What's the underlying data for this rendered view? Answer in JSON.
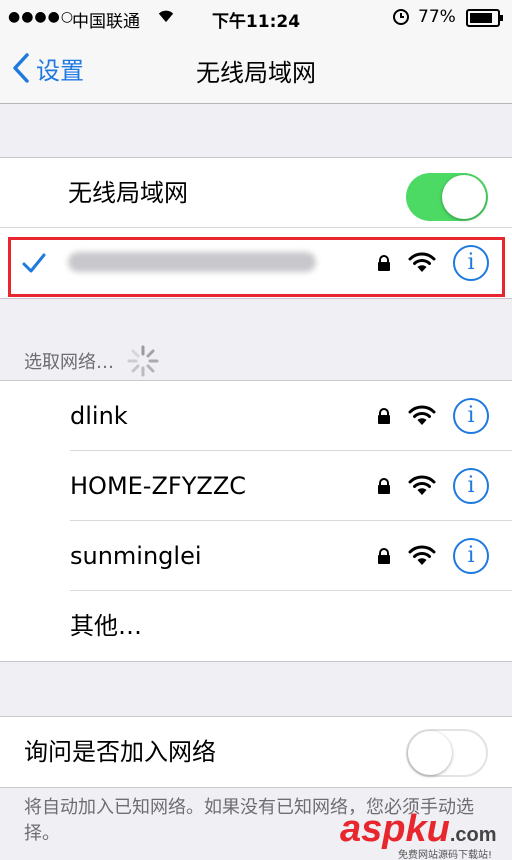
{
  "status_bar": {
    "signal": "●●●●○",
    "carrier": "中国联通",
    "time": "下午11:24",
    "battery": "77%"
  },
  "nav": {
    "back_label": "设置",
    "title": "无线局域网"
  },
  "wifi_toggle": {
    "label": "无线局域网",
    "on": true
  },
  "connected_network": {
    "name_obscured": true,
    "secured": true
  },
  "choose_network": {
    "header": "选取网络…",
    "networks": [
      {
        "name": "dlink",
        "secured": true
      },
      {
        "name": "HOME-ZFYZZC",
        "secured": true
      },
      {
        "name": "sunminglei",
        "secured": true
      }
    ],
    "other_label": "其他…"
  },
  "ask_to_join": {
    "label": "询问是否加入网络",
    "on": false,
    "footer": "将自动加入已知网络。如果没有已知网络，您必须手动选择。"
  },
  "watermark": {
    "brand": "aspku",
    "suffix": ".com",
    "tagline": "免费网站源码下载站!"
  },
  "colors": {
    "accent": "#1f7ae0",
    "toggle_on": "#4cd964",
    "highlight": "#e8262d"
  }
}
